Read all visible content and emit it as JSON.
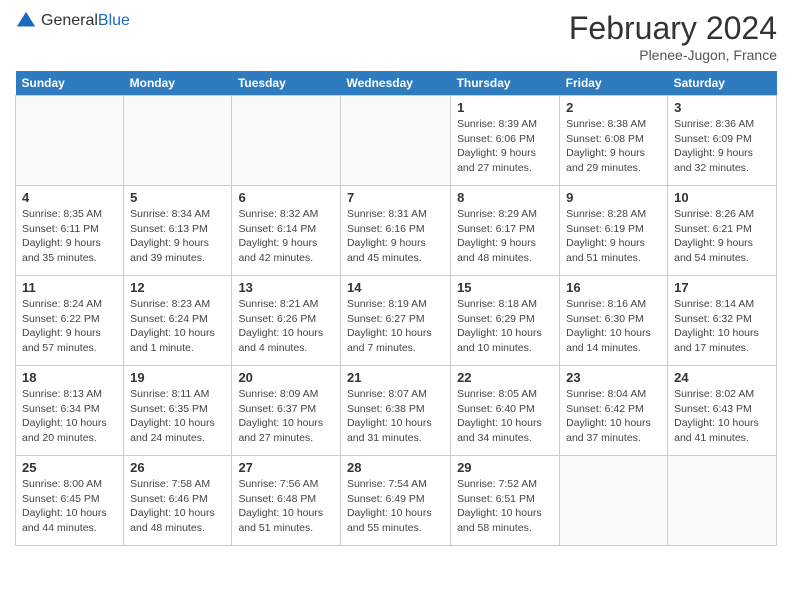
{
  "header": {
    "logo_general": "General",
    "logo_blue": "Blue",
    "month_title": "February 2024",
    "location": "Plenee-Jugon, France"
  },
  "days_of_week": [
    "Sunday",
    "Monday",
    "Tuesday",
    "Wednesday",
    "Thursday",
    "Friday",
    "Saturday"
  ],
  "weeks": [
    [
      {
        "day": "",
        "sunrise": "",
        "sunset": "",
        "daylight": ""
      },
      {
        "day": "",
        "sunrise": "",
        "sunset": "",
        "daylight": ""
      },
      {
        "day": "",
        "sunrise": "",
        "sunset": "",
        "daylight": ""
      },
      {
        "day": "",
        "sunrise": "",
        "sunset": "",
        "daylight": ""
      },
      {
        "day": "1",
        "sunrise": "8:39 AM",
        "sunset": "6:06 PM",
        "daylight": "9 hours and 27 minutes."
      },
      {
        "day": "2",
        "sunrise": "8:38 AM",
        "sunset": "6:08 PM",
        "daylight": "9 hours and 29 minutes."
      },
      {
        "day": "3",
        "sunrise": "8:36 AM",
        "sunset": "6:09 PM",
        "daylight": "9 hours and 32 minutes."
      }
    ],
    [
      {
        "day": "4",
        "sunrise": "8:35 AM",
        "sunset": "6:11 PM",
        "daylight": "9 hours and 35 minutes."
      },
      {
        "day": "5",
        "sunrise": "8:34 AM",
        "sunset": "6:13 PM",
        "daylight": "9 hours and 39 minutes."
      },
      {
        "day": "6",
        "sunrise": "8:32 AM",
        "sunset": "6:14 PM",
        "daylight": "9 hours and 42 minutes."
      },
      {
        "day": "7",
        "sunrise": "8:31 AM",
        "sunset": "6:16 PM",
        "daylight": "9 hours and 45 minutes."
      },
      {
        "day": "8",
        "sunrise": "8:29 AM",
        "sunset": "6:17 PM",
        "daylight": "9 hours and 48 minutes."
      },
      {
        "day": "9",
        "sunrise": "8:28 AM",
        "sunset": "6:19 PM",
        "daylight": "9 hours and 51 minutes."
      },
      {
        "day": "10",
        "sunrise": "8:26 AM",
        "sunset": "6:21 PM",
        "daylight": "9 hours and 54 minutes."
      }
    ],
    [
      {
        "day": "11",
        "sunrise": "8:24 AM",
        "sunset": "6:22 PM",
        "daylight": "9 hours and 57 minutes."
      },
      {
        "day": "12",
        "sunrise": "8:23 AM",
        "sunset": "6:24 PM",
        "daylight": "10 hours and 1 minute."
      },
      {
        "day": "13",
        "sunrise": "8:21 AM",
        "sunset": "6:26 PM",
        "daylight": "10 hours and 4 minutes."
      },
      {
        "day": "14",
        "sunrise": "8:19 AM",
        "sunset": "6:27 PM",
        "daylight": "10 hours and 7 minutes."
      },
      {
        "day": "15",
        "sunrise": "8:18 AM",
        "sunset": "6:29 PM",
        "daylight": "10 hours and 10 minutes."
      },
      {
        "day": "16",
        "sunrise": "8:16 AM",
        "sunset": "6:30 PM",
        "daylight": "10 hours and 14 minutes."
      },
      {
        "day": "17",
        "sunrise": "8:14 AM",
        "sunset": "6:32 PM",
        "daylight": "10 hours and 17 minutes."
      }
    ],
    [
      {
        "day": "18",
        "sunrise": "8:13 AM",
        "sunset": "6:34 PM",
        "daylight": "10 hours and 20 minutes."
      },
      {
        "day": "19",
        "sunrise": "8:11 AM",
        "sunset": "6:35 PM",
        "daylight": "10 hours and 24 minutes."
      },
      {
        "day": "20",
        "sunrise": "8:09 AM",
        "sunset": "6:37 PM",
        "daylight": "10 hours and 27 minutes."
      },
      {
        "day": "21",
        "sunrise": "8:07 AM",
        "sunset": "6:38 PM",
        "daylight": "10 hours and 31 minutes."
      },
      {
        "day": "22",
        "sunrise": "8:05 AM",
        "sunset": "6:40 PM",
        "daylight": "10 hours and 34 minutes."
      },
      {
        "day": "23",
        "sunrise": "8:04 AM",
        "sunset": "6:42 PM",
        "daylight": "10 hours and 37 minutes."
      },
      {
        "day": "24",
        "sunrise": "8:02 AM",
        "sunset": "6:43 PM",
        "daylight": "10 hours and 41 minutes."
      }
    ],
    [
      {
        "day": "25",
        "sunrise": "8:00 AM",
        "sunset": "6:45 PM",
        "daylight": "10 hours and 44 minutes."
      },
      {
        "day": "26",
        "sunrise": "7:58 AM",
        "sunset": "6:46 PM",
        "daylight": "10 hours and 48 minutes."
      },
      {
        "day": "27",
        "sunrise": "7:56 AM",
        "sunset": "6:48 PM",
        "daylight": "10 hours and 51 minutes."
      },
      {
        "day": "28",
        "sunrise": "7:54 AM",
        "sunset": "6:49 PM",
        "daylight": "10 hours and 55 minutes."
      },
      {
        "day": "29",
        "sunrise": "7:52 AM",
        "sunset": "6:51 PM",
        "daylight": "10 hours and 58 minutes."
      },
      {
        "day": "",
        "sunrise": "",
        "sunset": "",
        "daylight": ""
      },
      {
        "day": "",
        "sunrise": "",
        "sunset": "",
        "daylight": ""
      }
    ]
  ],
  "labels": {
    "sunrise_prefix": "Sunrise: ",
    "sunset_prefix": "Sunset: ",
    "daylight_prefix": "Daylight: "
  }
}
